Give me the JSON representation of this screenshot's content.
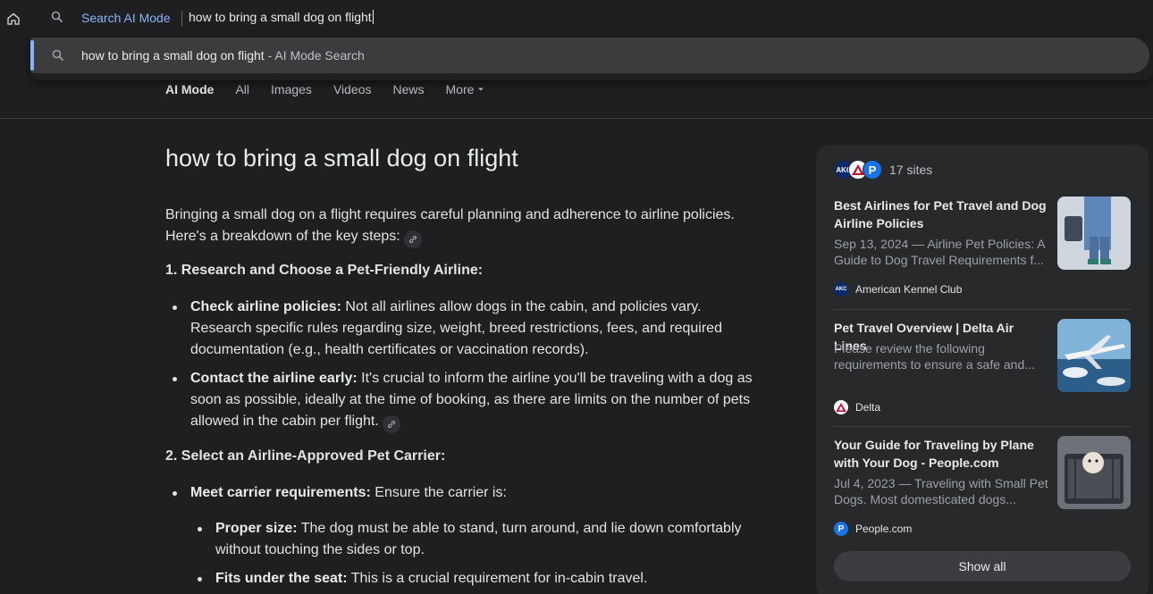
{
  "omnibox": {
    "keyword": "Search AI Mode",
    "query": "how to bring a small dog on flight"
  },
  "suggestion": {
    "text": "how to bring a small dog on flight",
    "hint": " - AI Mode Search"
  },
  "tabs": {
    "ai_mode": "AI Mode",
    "all": "All",
    "images": "Images",
    "videos": "Videos",
    "news": "News",
    "more": "More"
  },
  "answer": {
    "title": "how to bring a small dog on flight",
    "intro": "Bringing a small dog on a flight requires careful planning and adherence to airline policies. Here's a breakdown of the key steps:",
    "step1": "1. Research and Choose a Pet-Friendly Airline:",
    "b1_label": "Check airline policies:",
    "b1_text": " Not all airlines allow dogs in the cabin, and policies vary. Research specific rules regarding size, weight, breed restrictions, fees, and required documentation (e.g., health certificates or vaccination records).",
    "b2_label": "Contact the airline early:",
    "b2_text": " It's crucial to inform the airline you'll be traveling with a dog as soon as possible, ideally at the time of booking, as there are limits on the number of pets allowed in the cabin per flight.",
    "step2": "2. Select an Airline-Approved Pet Carrier:",
    "b3_label": "Meet carrier requirements:",
    "b3_text": " Ensure the carrier is:",
    "b4_label": "Proper size:",
    "b4_text": " The dog must be able to stand, turn around, and lie down comfortably without touching the sides or top.",
    "b5_label": "Fits under the seat:",
    "b5_text": " This is a crucial requirement for in-cabin travel."
  },
  "sources": {
    "count": "17 sites",
    "fav_akc": "AKC",
    "fav_people": "P",
    "cards": [
      {
        "title": "Best Airlines for Pet Travel and Dog Airline Policies",
        "snippet": "Sep 13, 2024 — Airline Pet Policies: A Guide to Dog Travel Requirements f...",
        "source": "American Kennel Club",
        "icon_text": "AKC"
      },
      {
        "title": "Pet Travel Overview | Delta Air Lines",
        "snippet": "Please review the following requirements to ensure a safe and...",
        "source": "Delta",
        "icon_text": ""
      },
      {
        "title": "Your Guide for Traveling by Plane with Your Dog - People.com",
        "snippet": "Jul 4, 2023 — Traveling with Small Pet Dogs. Most domesticated dogs...",
        "source": "People.com",
        "icon_text": "P"
      }
    ],
    "show_all": "Show all"
  },
  "colors": {
    "background": "#1f1f21",
    "accent": "#8ab4f8",
    "panel": "#28292b"
  }
}
